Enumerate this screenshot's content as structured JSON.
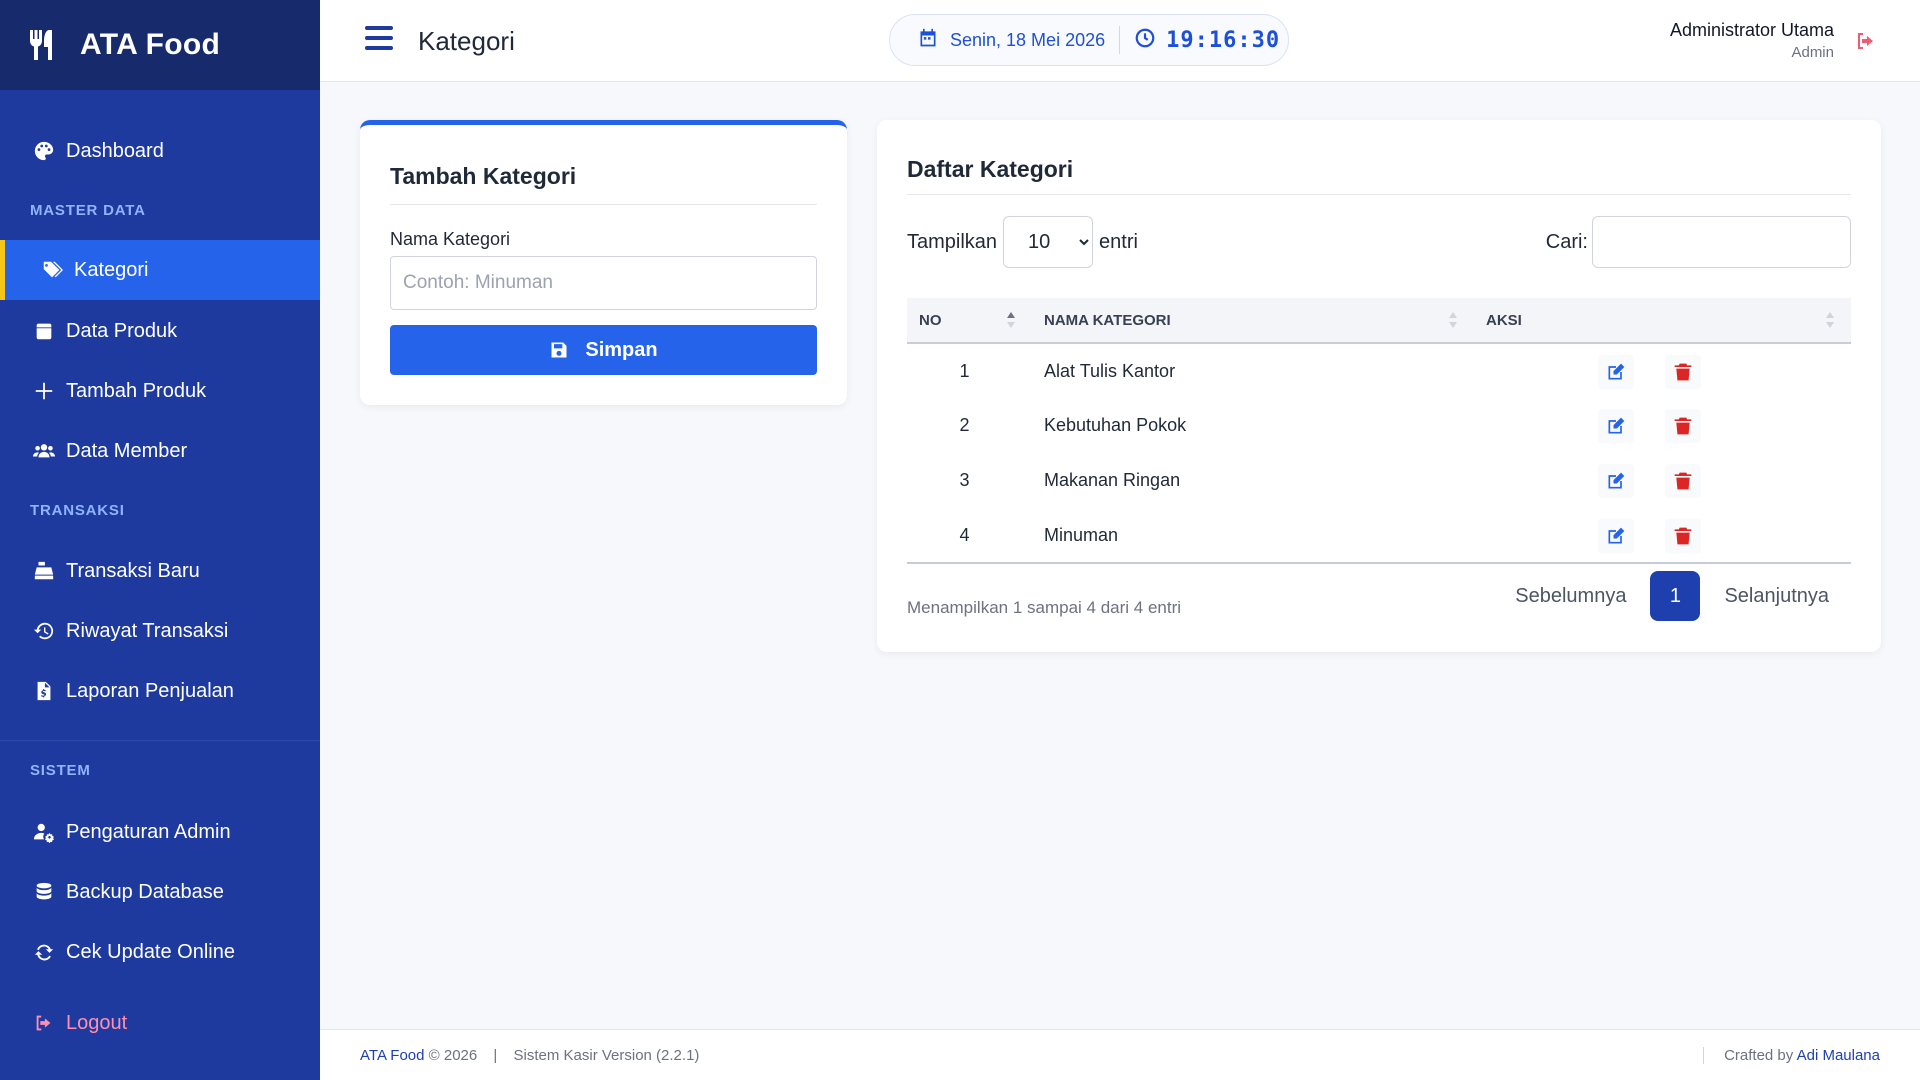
{
  "brand": {
    "name": "ATA Food",
    "icon": "utensils-icon"
  },
  "sidebar": {
    "sections": {
      "master": "MASTER DATA",
      "transaksi": "TRANSAKSI",
      "sistem": "SISTEM"
    },
    "items": [
      {
        "label": "Dashboard",
        "icon": "palette-icon"
      },
      {
        "label": "Kategori",
        "icon": "tags-icon",
        "active": true
      },
      {
        "label": "Data Produk",
        "icon": "box-icon"
      },
      {
        "label": "Tambah Produk",
        "icon": "plus-icon"
      },
      {
        "label": "Data Member",
        "icon": "users-icon"
      },
      {
        "label": "Transaksi Baru",
        "icon": "cash-register-icon"
      },
      {
        "label": "Riwayat Transaksi",
        "icon": "history-icon"
      },
      {
        "label": "Laporan Penjualan",
        "icon": "file-invoice-icon"
      },
      {
        "label": "Pengaturan Admin",
        "icon": "user-cog-icon"
      },
      {
        "label": "Backup Database",
        "icon": "database-icon"
      },
      {
        "label": "Cek Update Online",
        "icon": "sync-icon"
      }
    ],
    "logout": "Logout"
  },
  "topbar": {
    "title": "Kategori",
    "date": "Senin, 18 Mei 2026",
    "time": "19:16:30",
    "user_name": "Administrator Utama",
    "user_role": "Admin"
  },
  "form": {
    "title": "Tambah Kategori",
    "field_label": "Nama Kategori",
    "placeholder": "Contoh: Minuman",
    "value": "",
    "save_label": "Simpan"
  },
  "list": {
    "title": "Daftar Kategori",
    "show_label": "Tampilkan",
    "entries_label": "entri",
    "page_length": "10",
    "search_label": "Cari:",
    "columns": [
      "NO",
      "NAMA KATEGORI",
      "AKSI"
    ],
    "rows": [
      {
        "no": "1",
        "name": "Alat Tulis Kantor"
      },
      {
        "no": "2",
        "name": "Kebutuhan Pokok"
      },
      {
        "no": "3",
        "name": "Makanan Ringan"
      },
      {
        "no": "4",
        "name": "Minuman"
      }
    ],
    "info": "Menampilkan 1 sampai 4 dari 4 entri",
    "prev": "Sebelumnya",
    "current_page": "1",
    "next": "Selanjutnya"
  },
  "footer": {
    "brand": "ATA Food",
    "copyright": "© 2026",
    "version": "Sistem Kasir Version (2.2.1)",
    "crafted_by": "Crafted by",
    "author": "Adi Maulana"
  },
  "colors": {
    "sidebar": "#1e3a9e",
    "sidebar_brand": "#172a6b",
    "primary": "#2563eb",
    "active_border": "#f5c518",
    "danger": "#dc2626",
    "logout": "#ef5b73"
  }
}
